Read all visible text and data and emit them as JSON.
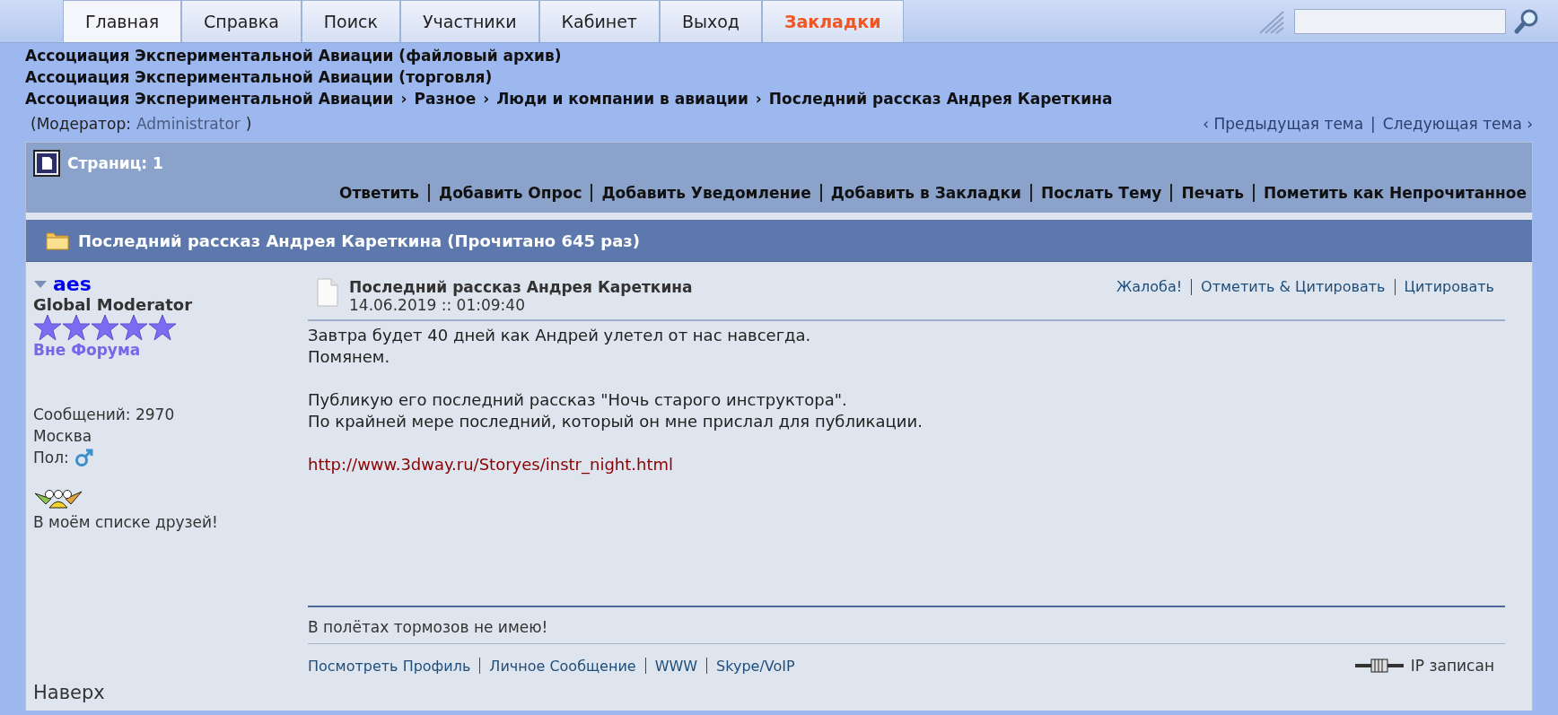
{
  "tabs": [
    {
      "label": "Главная",
      "selected": true,
      "kind": "normal"
    },
    {
      "label": "Справка",
      "selected": false,
      "kind": "normal"
    },
    {
      "label": "Поиск",
      "selected": false,
      "kind": "normal"
    },
    {
      "label": "Участники",
      "selected": false,
      "kind": "normal"
    },
    {
      "label": "Кабинет",
      "selected": false,
      "kind": "normal"
    },
    {
      "label": "Выход",
      "selected": false,
      "kind": "normal"
    },
    {
      "label": "Закладки",
      "selected": false,
      "kind": "accent"
    }
  ],
  "forums": [
    "Ассоциация Экспериментальной Авиации (файловый архив)",
    "Ассоциация Экспериментальной Авиации (торговля)"
  ],
  "breadcrumb": {
    "items": [
      "Ассоциация Экспериментальной Авиации",
      "Разное",
      "Люди и компании в авиации",
      "Последний рассказ Андрея Кареткина"
    ],
    "separator": "›"
  },
  "moderator": {
    "open": "(Модератор:",
    "name": "Administrator",
    "close": ")"
  },
  "topic_nav": {
    "prev": "‹ Предыдущая тема",
    "divider": "|",
    "next": "Следующая тема ›"
  },
  "pages": "Страниц: 1",
  "actions": [
    "Ответить",
    "Добавить Опрос",
    "Добавить Уведомление",
    "Добавить в Закладки",
    "Послать Тему",
    "Печать",
    "Пометить как Непрочитанное"
  ],
  "topic_title": "Последний рассказ Андрея Кареткина (Прочитано 645 раз)",
  "post": {
    "author": "aes",
    "rank": "Global Moderator",
    "stars": 5,
    "status": "Вне Форума",
    "posts": "Сообщений: 2970",
    "city": "Москва",
    "gender_label": "Пол:",
    "friend": "В моём списке друзей!",
    "top_link": "Наверх",
    "subject": "Последний рассказ Андрея Кареткина",
    "date": "14.06.2019 :: 01:09:40",
    "post_actions": [
      "Жалоба!",
      "Отметить & Цитировать",
      "Цитировать"
    ],
    "body": [
      [
        "Завтра будет 40 дней как Андрей улетел от нас навсегда.",
        "Помянем."
      ],
      [
        "Публикую его последний рассказ \"Ночь старого инструктора\".",
        "По крайней мере последний, который он мне прислал для  публикации."
      ]
    ],
    "link": "http://www.3dway.ru/Storyes/instr_night.html",
    "signature": "В полётах тормозов не имею!",
    "profile_links": [
      "Посмотреть Профиль",
      "Личное Сообщение",
      "WWW",
      "Skype/VoIP"
    ],
    "ip": "IP записан"
  }
}
